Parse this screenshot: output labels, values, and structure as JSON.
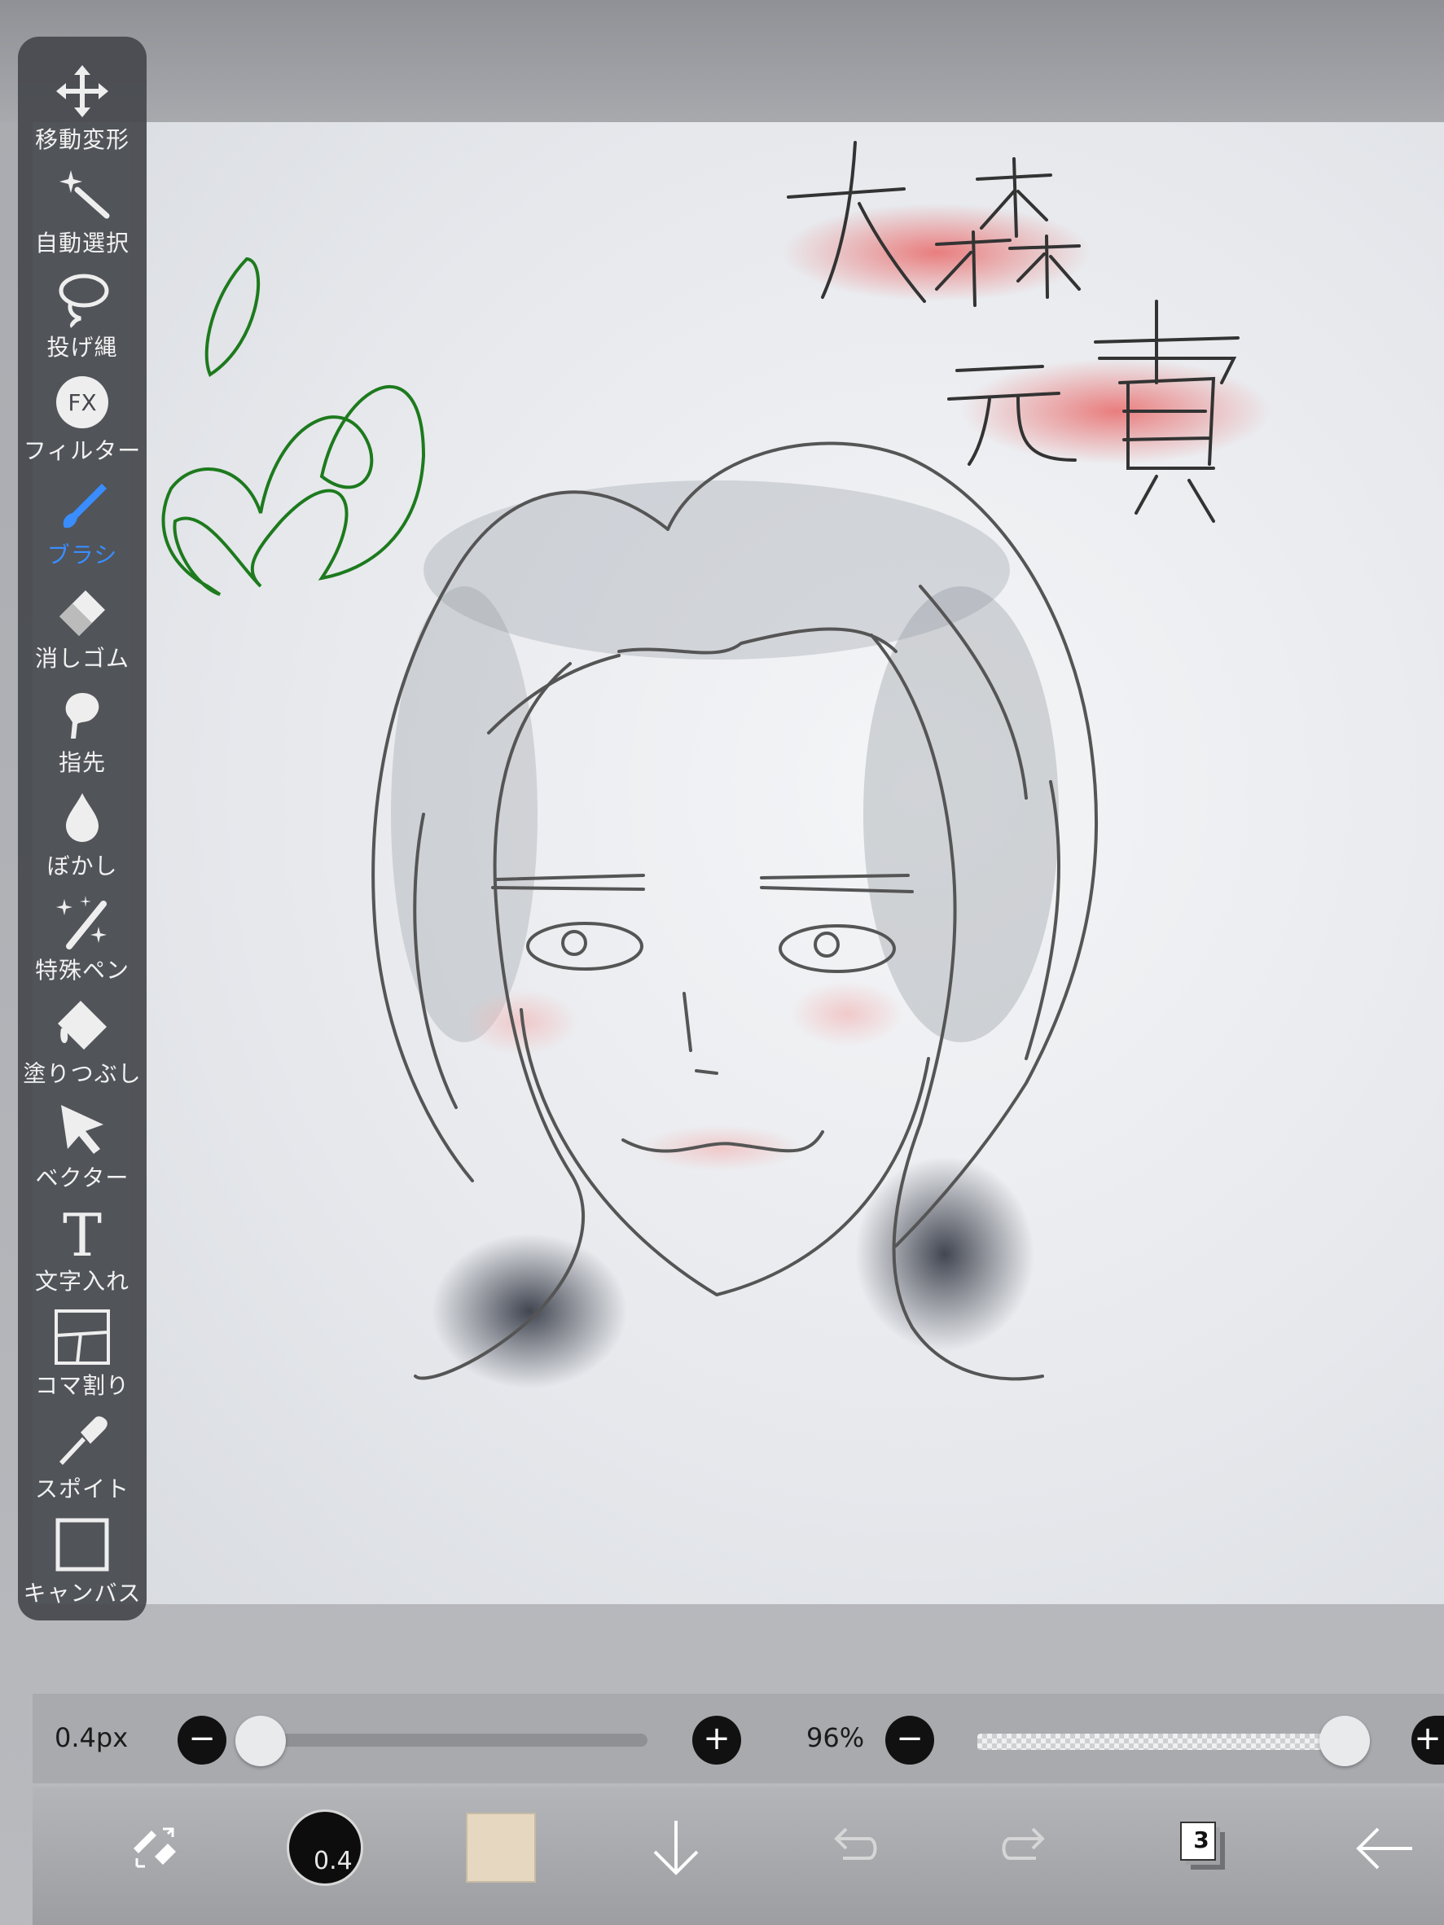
{
  "toolbar": {
    "tools": [
      {
        "label": "移動変形",
        "icon": "move-transform-icon"
      },
      {
        "label": "自動選択",
        "icon": "magic-wand-icon"
      },
      {
        "label": "投げ縄",
        "icon": "lasso-icon"
      },
      {
        "label": "フィルター",
        "icon": "fx-filter-icon"
      },
      {
        "label": "ブラシ",
        "icon": "brush-icon"
      },
      {
        "label": "消しゴム",
        "icon": "eraser-icon"
      },
      {
        "label": "指先",
        "icon": "finger-smudge-icon"
      },
      {
        "label": "ぼかし",
        "icon": "blur-drop-icon"
      },
      {
        "label": "特殊ペン",
        "icon": "special-pen-icon"
      },
      {
        "label": "塗りつぶし",
        "icon": "bucket-fill-icon"
      },
      {
        "label": "ベクター",
        "icon": "vector-cursor-icon"
      },
      {
        "label": "文字入れ",
        "icon": "text-tool-icon"
      },
      {
        "label": "コマ割り",
        "icon": "frame-divider-icon"
      },
      {
        "label": "スポイト",
        "icon": "eyedropper-icon"
      },
      {
        "label": "キャンバス",
        "icon": "canvas-icon"
      }
    ],
    "active_tool": "ブラシ",
    "fx_text": "FX",
    "text_icon_glyph": "T"
  },
  "sliders": {
    "brush_size": "0.4px",
    "opacity": "96%",
    "minus": "−",
    "plus": "+",
    "brush_size_level": 0.02,
    "opacity_level": 0.96
  },
  "bottom_bar": {
    "brush_preview_value": "0.4",
    "color": "#e6d8c0",
    "layer_count": "3"
  },
  "colors": {
    "toolbar_bg": "#46484e",
    "active": "#3a8dff",
    "green_stroke": "#1f7a1f",
    "pink_highlight": "#e06b6b"
  }
}
